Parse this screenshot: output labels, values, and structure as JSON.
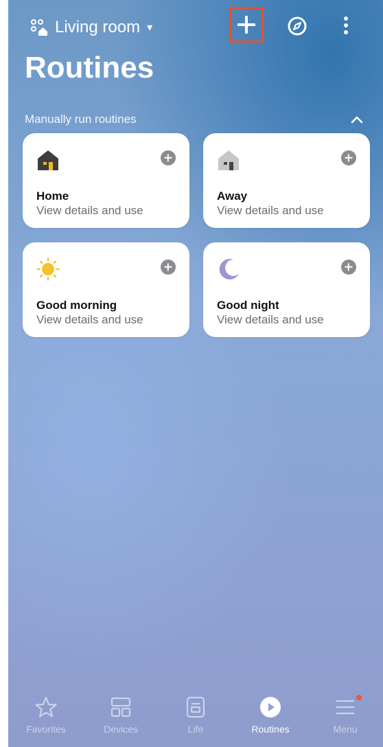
{
  "header": {
    "location_name": "Living room",
    "location_icon": "home-devices-icon",
    "caret": "▾",
    "actions": {
      "add_icon": "plus-icon",
      "discover_icon": "compass-icon",
      "more_icon": "more-vertical-icon",
      "add_highlight_color": "#e8512d"
    }
  },
  "page": {
    "title": "Routines"
  },
  "section": {
    "label": "Manually run routines",
    "collapse_icon": "chevron-up-icon"
  },
  "routines": [
    {
      "title": "Home",
      "subtitle": "View details and use",
      "icon": "house-dark-icon"
    },
    {
      "title": "Away",
      "subtitle": "View details and use",
      "icon": "house-light-icon"
    },
    {
      "title": "Good morning",
      "subtitle": "View details and use",
      "icon": "sun-icon"
    },
    {
      "title": "Good night",
      "subtitle": "View details and use",
      "icon": "moon-icon"
    }
  ],
  "bottom_nav": {
    "items": [
      {
        "label": "Favorites",
        "icon": "star-icon",
        "active": false
      },
      {
        "label": "Devices",
        "icon": "devices-grid-icon",
        "active": false
      },
      {
        "label": "Life",
        "icon": "life-doc-icon",
        "active": false
      },
      {
        "label": "Routines",
        "icon": "play-circle-icon",
        "active": true
      },
      {
        "label": "Menu",
        "icon": "menu-icon",
        "active": false,
        "has_badge": true
      }
    ],
    "badge_color": "#f05a2c"
  }
}
